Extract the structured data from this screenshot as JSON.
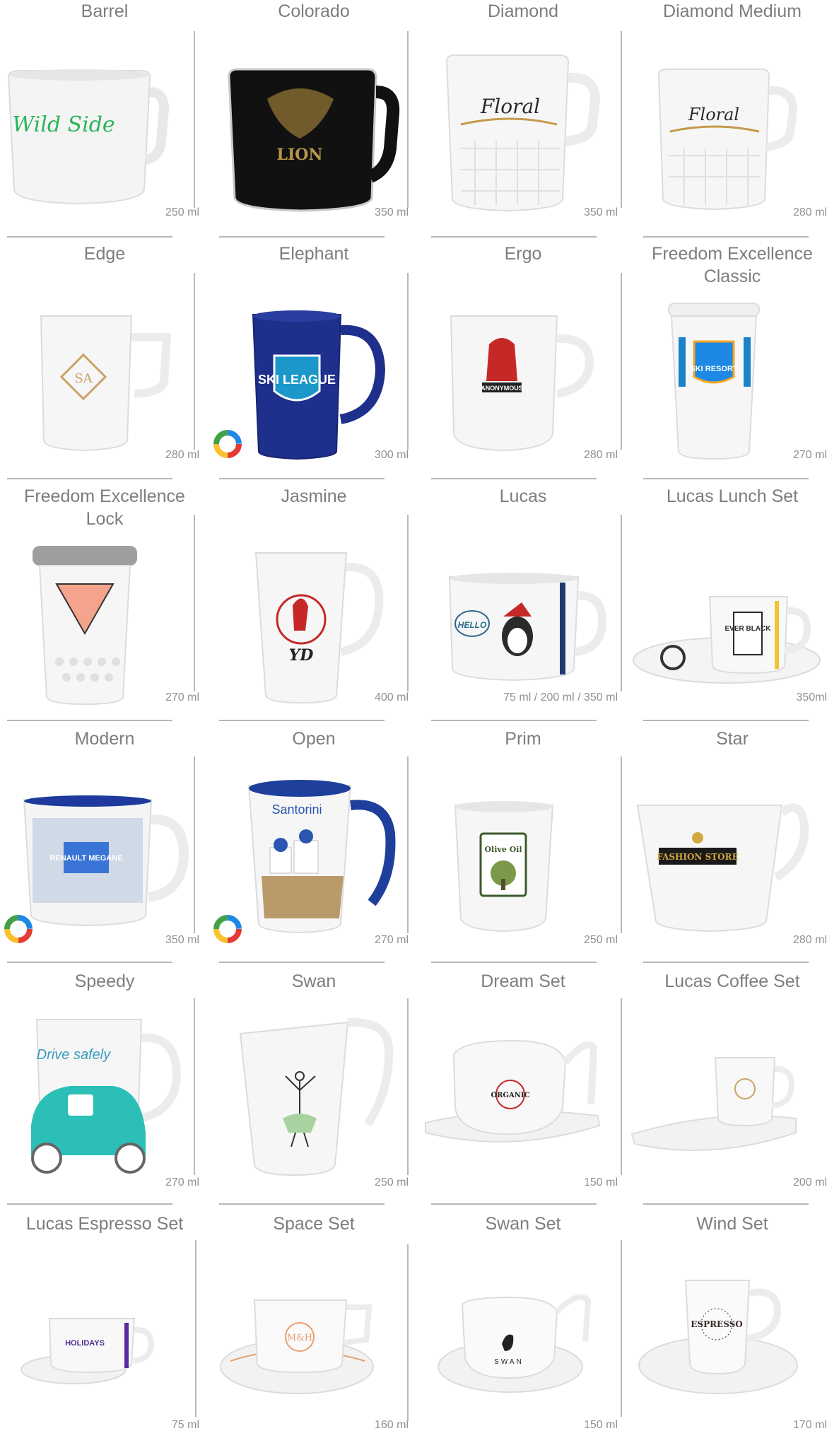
{
  "products": [
    {
      "name": "Barrel",
      "capacity": "250 ml",
      "print": "Wild Side",
      "icon": "barrel-mug-icon"
    },
    {
      "name": "Colorado",
      "capacity": "350 ml",
      "print": "LION",
      "icon": "colorado-mug-icon"
    },
    {
      "name": "Diamond",
      "capacity": "350 ml",
      "print": "Floral",
      "icon": "diamond-mug-icon"
    },
    {
      "name": "Diamond Medium",
      "capacity": "280 ml",
      "print": "Floral",
      "icon": "diamond-medium-mug-icon"
    },
    {
      "name": "Edge",
      "capacity": "280 ml",
      "print": "SA",
      "icon": "edge-mug-icon"
    },
    {
      "name": "Elephant",
      "capacity": "300 ml",
      "print": "SKI LEAGUE",
      "icon": "elephant-mug-icon",
      "color_options": true
    },
    {
      "name": "Ergo",
      "capacity": "280 ml",
      "print": "ANONYMOUS",
      "icon": "ergo-mug-icon"
    },
    {
      "name": "Freedom Excellence Classic",
      "capacity": "270 ml",
      "print": "SKI RESORT",
      "icon": "freedom-classic-mug-icon"
    },
    {
      "name": "Freedom Excellence Lock",
      "capacity": "270 ml",
      "print": "",
      "icon": "freedom-lock-mug-icon"
    },
    {
      "name": "Jasmine",
      "capacity": "400 ml",
      "print": "YD",
      "icon": "jasmine-mug-icon"
    },
    {
      "name": "Lucas",
      "capacity": "75 ml / 200 ml / 350 ml",
      "print": "HELLO",
      "icon": "lucas-mug-icon"
    },
    {
      "name": "Lucas Lunch Set",
      "capacity": "350ml",
      "print": "EVER BLACK",
      "icon": "lucas-lunch-set-icon"
    },
    {
      "name": "Modern",
      "capacity": "350 ml",
      "print": "RENAULT MEGANE",
      "icon": "modern-mug-icon",
      "color_options": true
    },
    {
      "name": "Open",
      "capacity": "270 ml",
      "print": "Santorini",
      "icon": "open-mug-icon",
      "color_options": true
    },
    {
      "name": "Prim",
      "capacity": "250 ml",
      "print": "Olive Oil",
      "icon": "prim-mug-icon"
    },
    {
      "name": "Star",
      "capacity": "280 ml",
      "print": "FASHION STORE",
      "icon": "star-mug-icon"
    },
    {
      "name": "Speedy",
      "capacity": "270 ml",
      "print": "Drive safely",
      "icon": "speedy-mug-icon"
    },
    {
      "name": "Swan",
      "capacity": "250 ml",
      "print": "",
      "icon": "swan-mug-icon"
    },
    {
      "name": "Dream Set",
      "capacity": "150 ml",
      "print": "ORGANIC",
      "icon": "dream-set-icon"
    },
    {
      "name": "Lucas Coffee Set",
      "capacity": "200 ml",
      "print": "",
      "icon": "lucas-coffee-set-icon"
    },
    {
      "name": "Lucas Espresso Set",
      "capacity": "75 ml",
      "print": "HOLIDAYS",
      "icon": "lucas-espresso-set-icon"
    },
    {
      "name": "Space Set",
      "capacity": "160 ml",
      "print": "M&H",
      "icon": "space-set-icon"
    },
    {
      "name": "Swan Set",
      "capacity": "150 ml",
      "print": "SWAN",
      "icon": "swan-set-icon"
    },
    {
      "name": "Wind Set",
      "capacity": "170 ml",
      "print": "ESPRESSO",
      "icon": "wind-set-icon"
    }
  ],
  "colors": {
    "text": "#7d7d7d",
    "divider": "#b8b8b8",
    "accent_blue": "#1e2f8c",
    "accent_black": "#101010"
  }
}
